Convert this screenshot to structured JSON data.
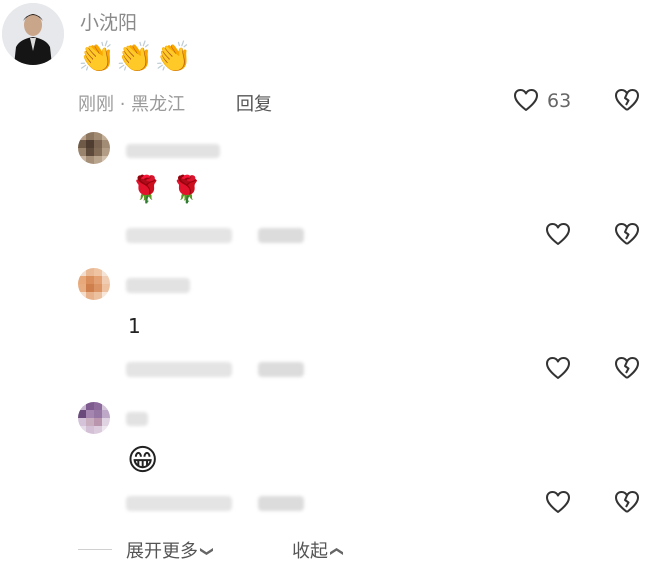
{
  "comment": {
    "username": "小沈阳",
    "content": "👏👏👏",
    "meta": "刚刚 · 黑龙江",
    "reply_label": "回复",
    "like_count": "63"
  },
  "replies": [
    {
      "content": "🌹 🌹"
    },
    {
      "content": "1"
    },
    {
      "content": "😁"
    }
  ],
  "footer": {
    "expand_label": "展开更多",
    "collapse_label": "收起"
  }
}
